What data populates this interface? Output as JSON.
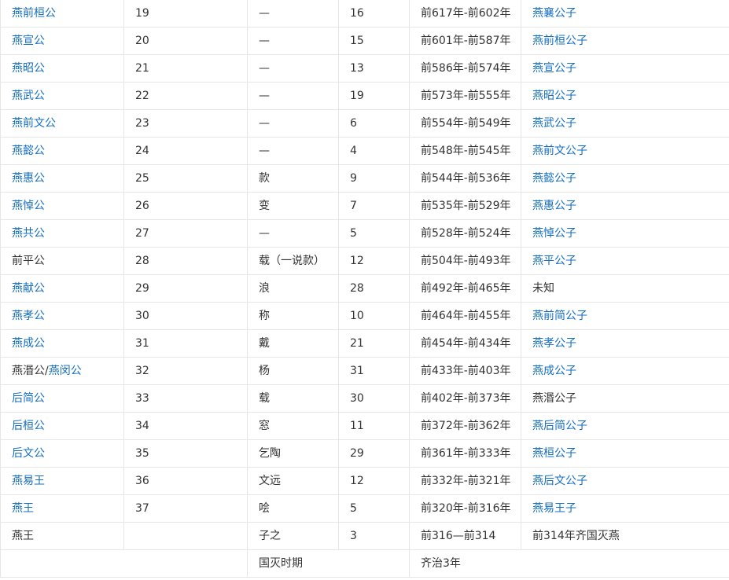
{
  "rows": [
    {
      "name": "燕前桓公",
      "name_link": true,
      "order": "19",
      "personal_name": "—",
      "years": "16",
      "reign": "前617年-前602年",
      "relation": "燕襄公子",
      "relation_link": true
    },
    {
      "name": "燕宣公",
      "name_link": true,
      "order": "20",
      "personal_name": "—",
      "years": "15",
      "reign": "前601年-前587年",
      "relation": "燕前桓公子",
      "relation_link": true
    },
    {
      "name": "燕昭公",
      "name_link": true,
      "order": "21",
      "personal_name": "—",
      "years": "13",
      "reign": "前586年-前574年",
      "relation": "燕宣公子",
      "relation_link": true
    },
    {
      "name": "燕武公",
      "name_link": true,
      "order": "22",
      "personal_name": "—",
      "years": "19",
      "reign": "前573年-前555年",
      "relation": "燕昭公子",
      "relation_link": true
    },
    {
      "name": "燕前文公",
      "name_link": true,
      "order": "23",
      "personal_name": "—",
      "years": "6",
      "reign": "前554年-前549年",
      "relation": "燕武公子",
      "relation_link": true
    },
    {
      "name": "燕懿公",
      "name_link": true,
      "order": "24",
      "personal_name": "—",
      "years": "4",
      "reign": "前548年-前545年",
      "relation": "燕前文公子",
      "relation_link": true
    },
    {
      "name": "燕惠公",
      "name_link": true,
      "order": "25",
      "personal_name": "款",
      "years": "9",
      "reign": "前544年-前536年",
      "relation": "燕懿公子",
      "relation_link": true
    },
    {
      "name": "燕悼公",
      "name_link": true,
      "order": "26",
      "personal_name": "变",
      "years": "7",
      "reign": "前535年-前529年",
      "relation": "燕惠公子",
      "relation_link": true
    },
    {
      "name": "燕共公",
      "name_link": true,
      "order": "27",
      "personal_name": "—",
      "years": "5",
      "reign": "前528年-前524年",
      "relation": "燕悼公子",
      "relation_link": true
    },
    {
      "name": "前平公",
      "name_link": false,
      "order": "28",
      "personal_name": "载（一说款）",
      "years": "12",
      "reign": "前504年-前493年",
      "relation": "燕平公子",
      "relation_link": true
    },
    {
      "name": "燕献公",
      "name_link": true,
      "order": "29",
      "personal_name": "浪",
      "years": "28",
      "reign": "前492年-前465年",
      "relation": "未知",
      "relation_link": false
    },
    {
      "name": "燕孝公",
      "name_link": true,
      "order": "30",
      "personal_name": "称",
      "years": "10",
      "reign": "前464年-前455年",
      "relation": "燕前简公子",
      "relation_link": true
    },
    {
      "name": "燕成公",
      "name_link": true,
      "order": "31",
      "personal_name": "戴",
      "years": "21",
      "reign": "前454年-前434年",
      "relation": "燕孝公子",
      "relation_link": true
    },
    {
      "name_parts": [
        {
          "text": "燕湣公/",
          "link": false
        },
        {
          "text": "燕闵公",
          "link": true
        }
      ],
      "order": "32",
      "personal_name": "杨",
      "years": "31",
      "reign": "前433年-前403年",
      "relation": "燕成公子",
      "relation_link": true
    },
    {
      "name": "后简公",
      "name_link": true,
      "order": "33",
      "personal_name": "载",
      "years": "30",
      "reign": "前402年-前373年",
      "relation": "燕湣公子",
      "relation_link": false
    },
    {
      "name": "后桓公",
      "name_link": true,
      "order": "34",
      "personal_name": "窓",
      "years": "11",
      "reign": "前372年-前362年",
      "relation": "燕后简公子",
      "relation_link": true
    },
    {
      "name": "后文公",
      "name_link": true,
      "order": "35",
      "personal_name": "乞陶",
      "years": "29",
      "reign": "前361年-前333年",
      "relation": "燕桓公子",
      "relation_link": true
    },
    {
      "name": "燕易王",
      "name_link": true,
      "order": "36",
      "personal_name": "文远",
      "years": "12",
      "reign": "前332年-前321年",
      "relation": "燕后文公子",
      "relation_link": true
    },
    {
      "name": "燕王",
      "name_link": true,
      "order": "37",
      "personal_name": "哙",
      "years": "5",
      "reign": "前320年-前316年",
      "relation": "燕易王子",
      "relation_link": true
    },
    {
      "name": "燕王",
      "name_link": false,
      "order": "",
      "personal_name": "子之",
      "years": "3",
      "reign": "前316—前314",
      "relation": "前314年齐国灭燕",
      "relation_link": false
    }
  ],
  "footer": {
    "period_label": "国灭时期",
    "period_value": "齐治3年"
  }
}
